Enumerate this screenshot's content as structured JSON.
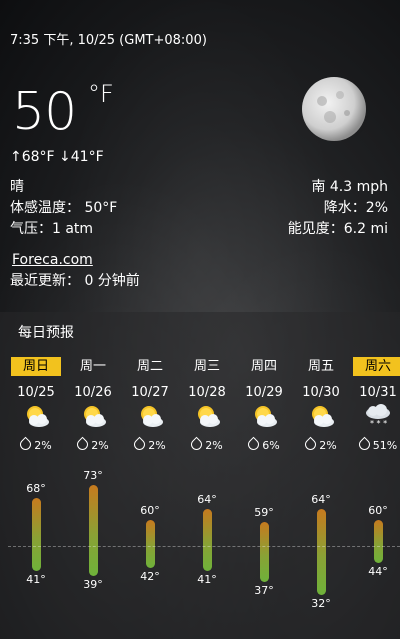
{
  "status": {
    "datetime": "7:35 下午, 10/25 (GMT+08:00)"
  },
  "current": {
    "temperature": "50",
    "unit": "°F",
    "high_low": "↑68°F ↓41°F",
    "condition": "晴",
    "feels_like": "体感温度：  50°F",
    "pressure": "气压：1 atm",
    "wind": "南 4.3 mph",
    "precipitation": "降水：2%",
    "visibility": "能见度：6.2 mi",
    "moon_icon": "moon-icon"
  },
  "source": {
    "link": "Foreca.com",
    "updated": "最近更新：  0 分钟前"
  },
  "forecast": {
    "title": "每日预报",
    "days": [
      {
        "day": "周日",
        "date": "10/25",
        "icon": "partly-sunny-icon",
        "precip": "2%",
        "high": "68°",
        "low": "41°",
        "active": true
      },
      {
        "day": "周一",
        "date": "10/26",
        "icon": "partly-sunny-icon",
        "precip": "2%",
        "high": "73°",
        "low": "39°",
        "active": false
      },
      {
        "day": "周二",
        "date": "10/27",
        "icon": "partly-sunny-icon",
        "precip": "2%",
        "high": "60°",
        "low": "42°",
        "active": false
      },
      {
        "day": "周三",
        "date": "10/28",
        "icon": "partly-sunny-icon",
        "precip": "2%",
        "high": "64°",
        "low": "41°",
        "active": false
      },
      {
        "day": "周四",
        "date": "10/29",
        "icon": "partly-sunny-icon",
        "precip": "6%",
        "high": "59°",
        "low": "37°",
        "active": false
      },
      {
        "day": "周五",
        "date": "10/30",
        "icon": "partly-sunny-icon",
        "precip": "2%",
        "high": "64°",
        "low": "32°",
        "active": false
      },
      {
        "day": "周六",
        "date": "10/31",
        "icon": "snow-cloud-icon",
        "precip": "51%",
        "high": "60°",
        "low": "44°",
        "active": true
      }
    ]
  },
  "colors": {
    "accent": "#f2c21e",
    "bar_top": "#c77a1e",
    "bar_bottom": "#6fb23a"
  }
}
